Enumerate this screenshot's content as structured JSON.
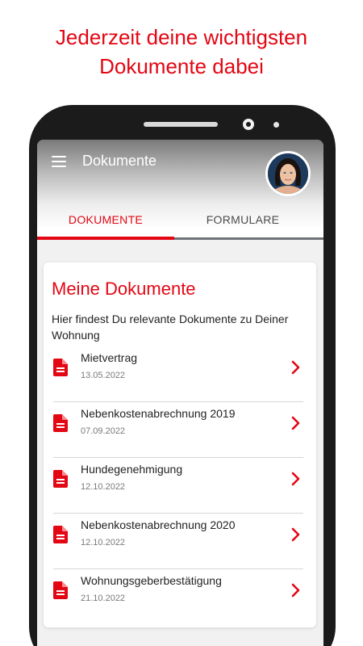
{
  "promo": {
    "line1": "Jederzeit deine wichtigsten",
    "line2": "Dokumente dabei"
  },
  "appbar": {
    "title": "Dokumente",
    "menu_icon": "hamburger-menu-icon",
    "avatar": "user-avatar-photo"
  },
  "tabs": [
    {
      "label": "DOKUMENTE",
      "active": true
    },
    {
      "label": "FORMULARE",
      "active": false
    }
  ],
  "card": {
    "title": "Meine Dokumente",
    "description": "Hier findest Du relevante Dokumente zu Deiner Wohnung"
  },
  "documents": [
    {
      "name": "Mietvertrag",
      "date": "13.05.2022"
    },
    {
      "name": "Nebenkostenabrechnung 2019",
      "date": "07.09.2022"
    },
    {
      "name": "Hundegenehmigung",
      "date": "12.10.2022"
    },
    {
      "name": "Nebenkostenabrechnung 2020",
      "date": "12.10.2022"
    },
    {
      "name": "Wohnungsgeberbestätigung",
      "date": "21.10.2022"
    }
  ],
  "colors": {
    "accent": "#e30613",
    "tab_inactive_line": "#6d7378",
    "background": "#f1f1f1"
  },
  "icons": {
    "document": "document-icon",
    "chevron": "chevron-right-icon"
  }
}
